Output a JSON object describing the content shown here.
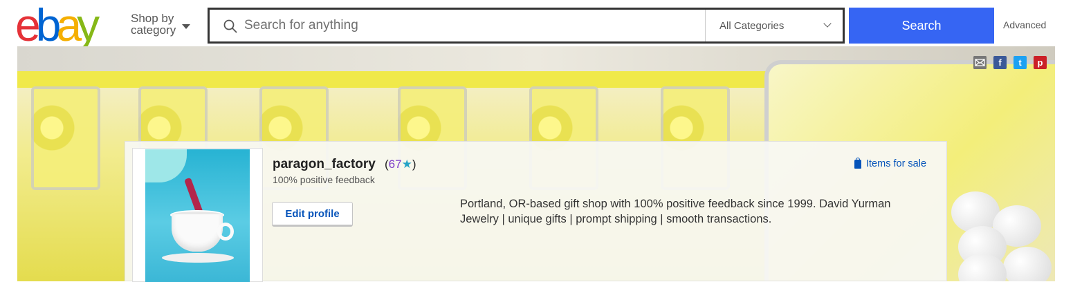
{
  "logo": {
    "letters": [
      "e",
      "b",
      "a",
      "y"
    ],
    "colors": [
      "#e53238",
      "#0064d2",
      "#f5af02",
      "#86b817"
    ]
  },
  "header": {
    "shop_by_line1": "Shop by",
    "shop_by_line2": "category",
    "search_placeholder": "Search for anything",
    "category_selected": "All Categories",
    "search_button": "Search",
    "advanced_link": "Advanced",
    "search_button_color": "#3665f3"
  },
  "social": {
    "icons": [
      {
        "name": "email-icon",
        "glyph": "",
        "color": "#777777"
      },
      {
        "name": "facebook-icon",
        "glyph": "f",
        "color": "#3b5998"
      },
      {
        "name": "twitter-icon",
        "glyph": "t",
        "color": "#1da1f2"
      },
      {
        "name": "pinterest-icon",
        "glyph": "p",
        "color": "#cb2027"
      }
    ]
  },
  "profile": {
    "username": "paragon_factory",
    "score_open": "(",
    "score": "67",
    "star": "★",
    "score_close": ")",
    "feedback": "100% positive feedback",
    "edit_button": "Edit profile",
    "items_link": "Items for sale",
    "description": "Portland, OR-based gift shop with 100% positive feedback since 1999. David Yurman Jewelry | unique gifts | prompt shipping | smooth transactions."
  }
}
